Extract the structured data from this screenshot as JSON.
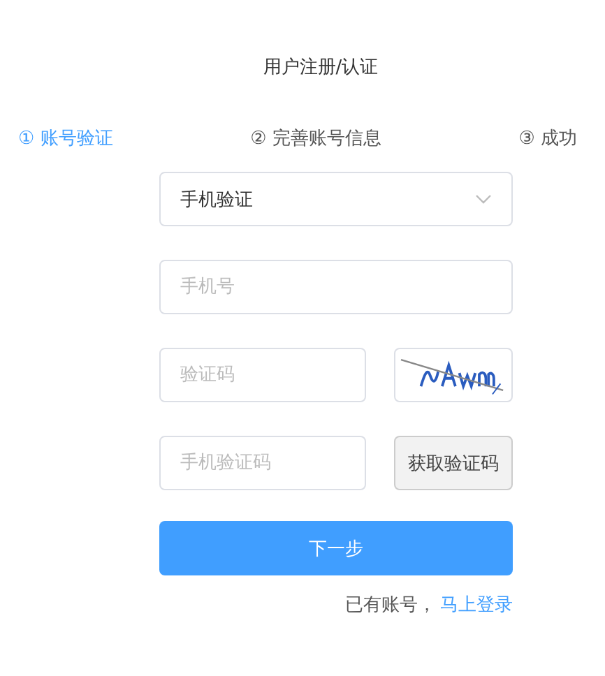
{
  "title": "用户注册/认证",
  "steps": [
    {
      "marker": "①",
      "label": "账号验证",
      "selected": true
    },
    {
      "marker": "②",
      "label": "完善账号信息",
      "selected": false
    },
    {
      "marker": "③",
      "label": "成功",
      "selected": false
    }
  ],
  "form": {
    "select": {
      "value": "手机验证"
    },
    "fields": [
      {
        "kind": "input",
        "placeholder": "手机号"
      },
      {
        "kind": "captcha",
        "placeholder": "验证码"
      },
      {
        "kind": "sms",
        "placeholder": "手机验证码",
        "button": "获取验证码"
      }
    ],
    "submit": "下一步",
    "login": {
      "prompt": "已有账号，",
      "link": "马上登录"
    }
  }
}
